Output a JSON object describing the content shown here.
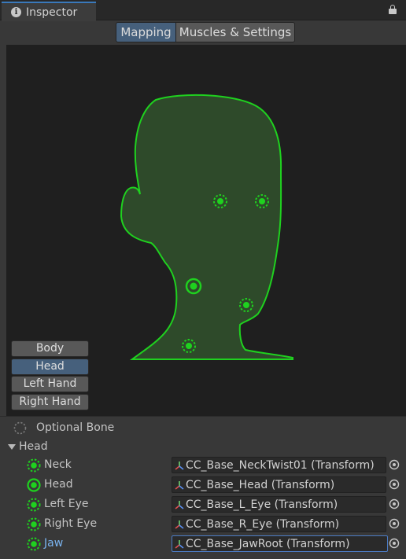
{
  "window": {
    "tab_title": "Inspector",
    "tab_icon": "info-icon",
    "lock_icon": "lock-icon"
  },
  "mode_toggle": {
    "active": "Mapping",
    "inactive": "Muscles & Settings"
  },
  "avatar_view": {
    "body_parts": [
      {
        "label": "Body",
        "active": false
      },
      {
        "label": "Head",
        "active": true
      },
      {
        "label": "Left Hand",
        "active": false
      },
      {
        "label": "Right Hand",
        "active": false
      }
    ],
    "colors": {
      "silhouette_fill": "#2e4a2a",
      "silhouette_stroke": "#1fd11f",
      "bone_green": "#1fd11f",
      "selected_button": "#46607c"
    }
  },
  "legend": {
    "optional_bone_label": "Optional Bone",
    "optional_bone_icon": "dashed-circle-icon"
  },
  "section": {
    "title": "Head",
    "expanded": true
  },
  "bones": [
    {
      "label": "Neck",
      "value": "CC_Base_NeckTwist01 (Transform)",
      "optional": true,
      "selected": false
    },
    {
      "label": "Head",
      "value": "CC_Base_Head (Transform)",
      "optional": false,
      "selected": false
    },
    {
      "label": "Left Eye",
      "value": "CC_Base_L_Eye (Transform)",
      "optional": true,
      "selected": false
    },
    {
      "label": "Right Eye",
      "value": "CC_Base_R_Eye (Transform)",
      "optional": true,
      "selected": false
    },
    {
      "label": "Jaw",
      "value": "CC_Base_JawRoot (Transform)",
      "optional": true,
      "selected": true
    }
  ]
}
